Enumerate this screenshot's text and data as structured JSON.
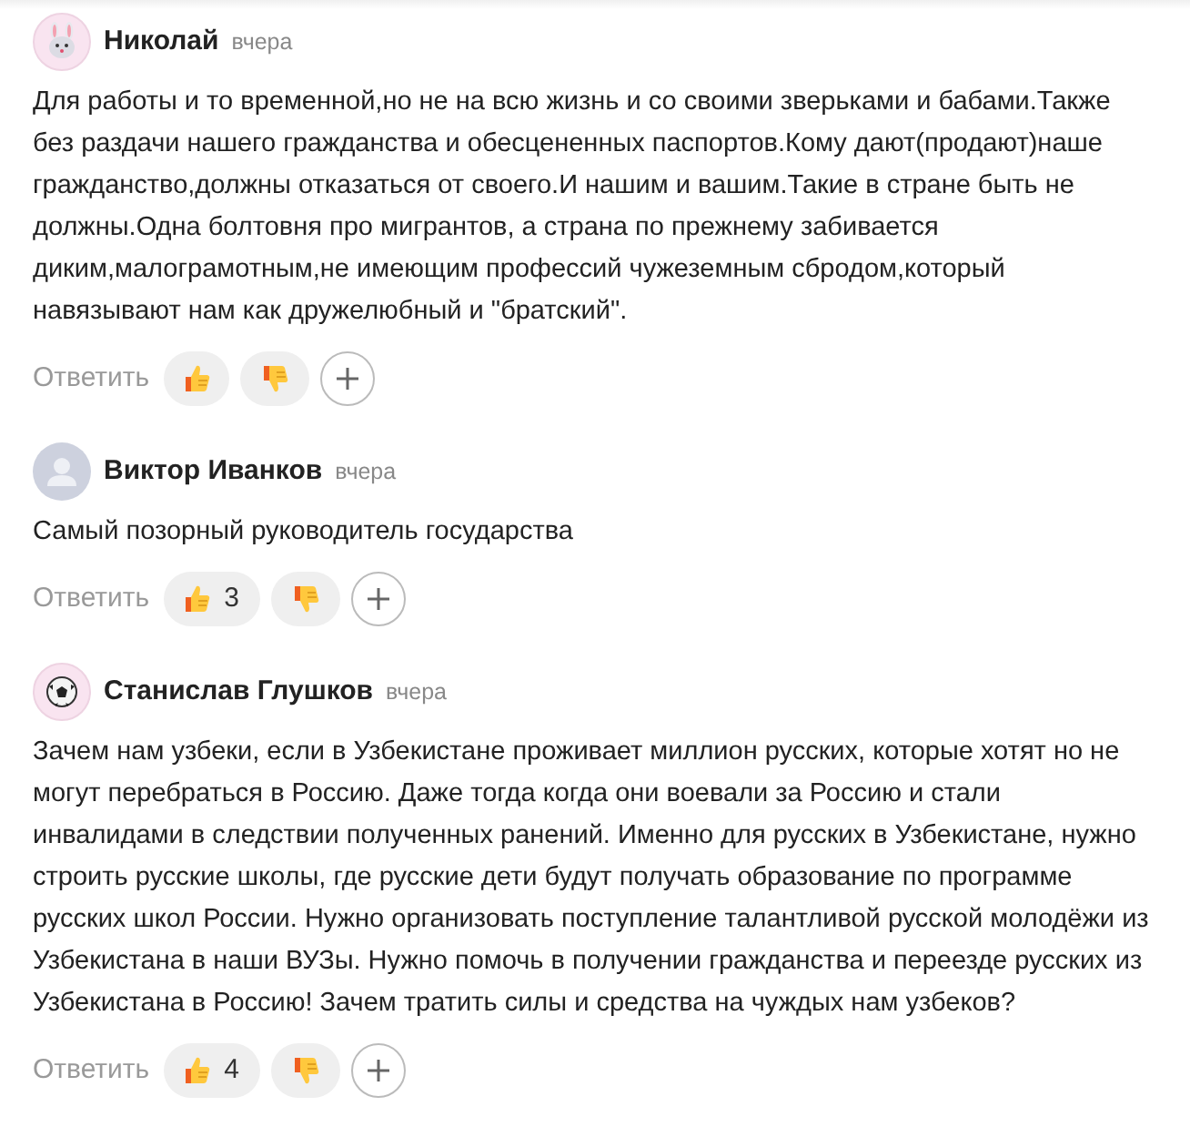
{
  "comments": [
    {
      "avatar": {
        "kind": "bunny"
      },
      "author": "Николай",
      "time": "вчера",
      "text": "Для работы и то временной,но не на всю жизнь и со своими зверьками и бабами.Также без раздачи нашего гражданства и обесцененных паспортов.Кому дают(продают)наше гражданство,должны отказаться от своего.И нашим и вашим.Такие в стране быть не должны.Одна болтовня про мигрантов, а страна по прежнему забивается диким,малограмотным,не имеющим профессий чужеземным сбродом,который навязывают нам как дружелюбный и \"братский\".",
      "reply": "Ответить"
    },
    {
      "avatar": {
        "kind": "person"
      },
      "author": "Виктор Иванков",
      "time": "вчера",
      "text": "Самый позорный руководитель государства",
      "reply": "Ответить",
      "likes": "3"
    },
    {
      "avatar": {
        "kind": "ball"
      },
      "author": "Станислав Глушков",
      "time": "вчера",
      "text": "Зачем нам узбеки, если в Узбекистане проживает миллион русских, которые хотят но не могут перебраться в Россию. Даже тогда когда они воевали за Россию и стали инвалидами в следствии полученных ранений. Именно для русских в Узбекистане, нужно строить русские школы, где русские дети будут получать образование по программе русских школ России. Нужно организовать поступление талантливой русской молодёжи из Узбекистана в наши ВУЗы. Нужно помочь в получении гражданства и переезде русских из Узбекистана в Россию! Зачем тратить силы и средства на чуждых нам узбеков?",
      "reply": "Ответить",
      "likes": "4"
    }
  ]
}
